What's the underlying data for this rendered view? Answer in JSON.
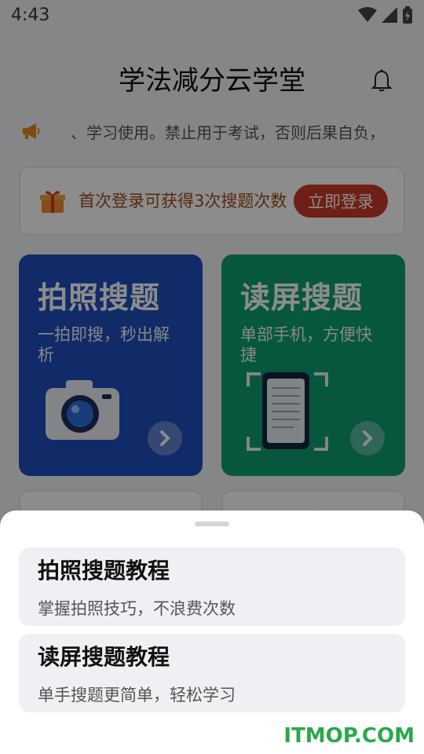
{
  "status_bar": {
    "time": "4:43"
  },
  "header": {
    "title": "学法减分云学堂"
  },
  "notice": {
    "text": "、学习使用。禁止用于考试，否则后果自负，"
  },
  "login_card": {
    "promo": "首次登录可获得3次搜题次数",
    "button": "立即登录"
  },
  "features": [
    {
      "title": "拍照搜题",
      "subtitle": "一拍即搜，秒出解析"
    },
    {
      "title": "读屏搜题",
      "subtitle": "单部手机，方便快捷"
    }
  ],
  "small_cards": [
    {
      "label": "操作说"
    },
    {
      "label": "文馆治"
    }
  ],
  "bottom_sheet": {
    "options": [
      {
        "title": "拍照搜题教程",
        "subtitle": "掌握拍照技巧，不浪费次数"
      },
      {
        "title": "读屏搜题教程",
        "subtitle": "单手搜题更简单，轻松学习"
      }
    ]
  },
  "watermark": "ITMOP.COM",
  "colors": {
    "photo_card": "#1f4fbf",
    "screen_card": "#0e9e74",
    "login_button": "#c83a2a",
    "watermark": "#2ba84a"
  }
}
